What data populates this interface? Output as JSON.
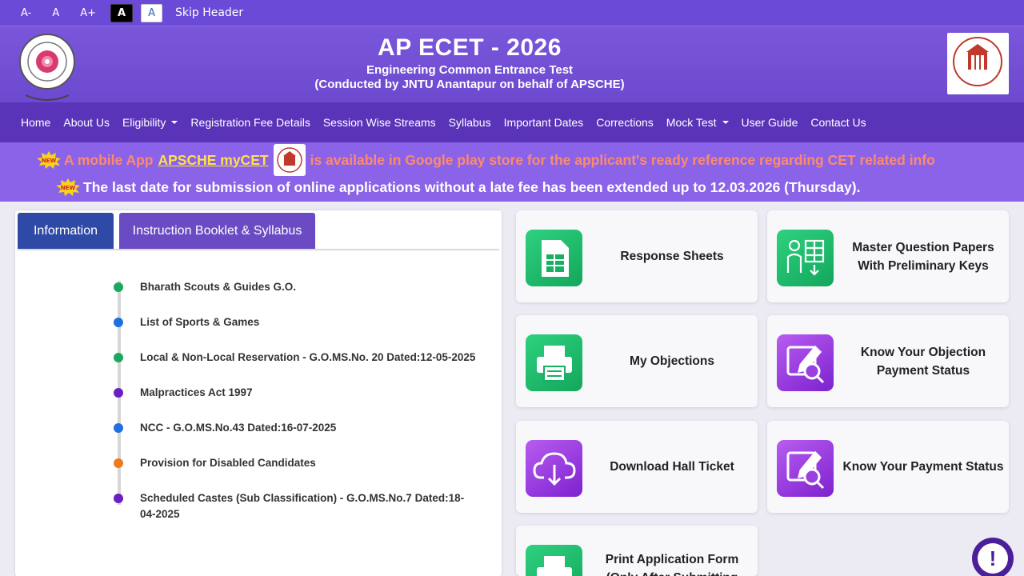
{
  "access_bar": {
    "decrease": "A-",
    "normal": "A",
    "increase": "A+",
    "dark_mode": "A",
    "light_mode": "A",
    "skip": "Skip Header"
  },
  "header": {
    "title": "AP ECET - 2026",
    "subtitle": "Engineering Common Entrance Test",
    "subtitle2": "(Conducted by JNTU Anantapur on behalf of APSCHE)"
  },
  "nav": {
    "items": [
      {
        "label": "Home"
      },
      {
        "label": "About Us"
      },
      {
        "label": "Eligibility"
      },
      {
        "label": "Registration Fee Details"
      },
      {
        "label": "Session Wise Streams"
      },
      {
        "label": "Syllabus"
      },
      {
        "label": "Important Dates"
      },
      {
        "label": "Corrections"
      },
      {
        "label": "Mock Test"
      },
      {
        "label": "User Guide"
      },
      {
        "label": "Contact Us"
      }
    ]
  },
  "banner": {
    "line1_prefix": "A mobile App",
    "line1_link": "APSCHE myCET",
    "line1_suffix": "is available in Google play store for the applicant's ready reference regarding CET related info",
    "line2": "The last date for submission of online applications without a late fee has been extended up to 12.03.2026 (Thursday).",
    "new_badge": "NEW"
  },
  "info_panel": {
    "tabs": [
      {
        "label": "Information"
      },
      {
        "label": "Instruction Booklet & Syllabus"
      }
    ],
    "items": [
      {
        "text": "Bharath Scouts & Guides G.O.",
        "color": "#1aa85f"
      },
      {
        "text": "List of Sports & Games",
        "color": "#1f6fe0"
      },
      {
        "text": "Local & Non-Local Reservation - G.O.MS.No. 20 Dated:12-05-2025",
        "color": "#1aa85f"
      },
      {
        "text": "Malpractices Act 1997",
        "color": "#6a1fc4"
      },
      {
        "text": "NCC - G.O.MS.No.43 Dated:16-07-2025",
        "color": "#1f6fe0"
      },
      {
        "text": "Provision for Disabled Candidates",
        "color": "#f07a1a"
      },
      {
        "text": "Scheduled Castes (Sub Classification) - G.O.MS.No.7 Dated:18-04-2025",
        "color": "#6a1fc4"
      }
    ]
  },
  "cards": [
    {
      "label": "Response Sheets",
      "icon": "spreadsheet-icon",
      "theme": "green"
    },
    {
      "label": "Master Question Papers With Preliminary Keys",
      "icon": "person-grid-icon",
      "theme": "green"
    },
    {
      "label": "My Objections",
      "icon": "printer-icon",
      "theme": "green"
    },
    {
      "label": "Know Your Objection Payment Status",
      "icon": "edit-search-icon",
      "theme": "purple"
    },
    {
      "label": "Download Hall Ticket",
      "icon": "cloud-download-icon",
      "theme": "purple"
    },
    {
      "label": "Know Your Payment Status",
      "icon": "edit-search-icon",
      "theme": "purple"
    },
    {
      "label": "Print Application Form (Only After Submitting",
      "icon": "printer-icon",
      "theme": "green"
    }
  ],
  "help": {
    "symbol": "!"
  },
  "colors": {
    "header_purple": "#7a56db",
    "nav_purple": "#5a34b8",
    "banner_purple": "#8a63e8",
    "banner_orange_text": "#ff8a6b",
    "banner_link_yellow": "#ffe04a",
    "tab_blue": "#2e4aa6",
    "tab_purple": "#6a4bc4",
    "icon_green": "#1fbf6e",
    "icon_purple": "#9a3fe0"
  }
}
